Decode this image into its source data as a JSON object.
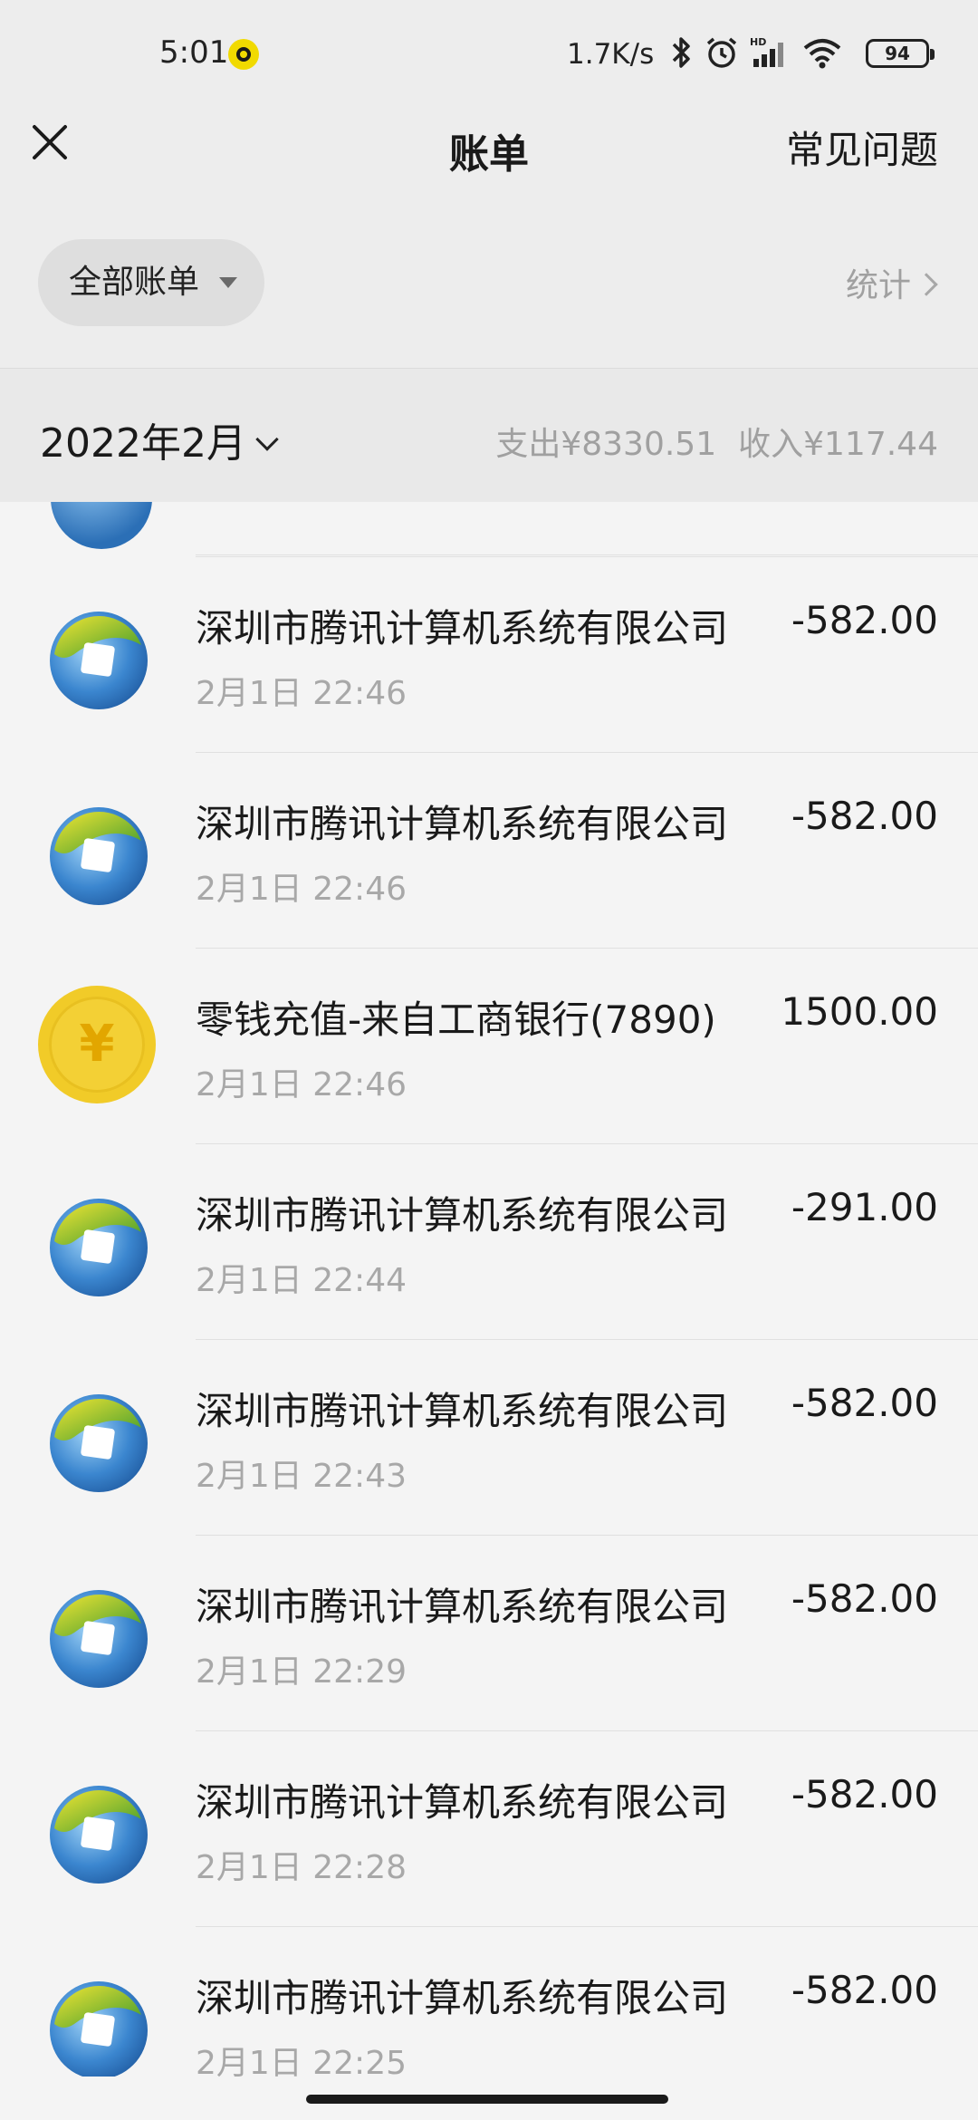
{
  "status_bar": {
    "time": "5:01",
    "net_speed": "1.7K/s",
    "battery": "94",
    "icons": [
      "bluetooth-icon",
      "alarm-icon",
      "hd-signal-icon",
      "wifi-icon",
      "battery-icon"
    ]
  },
  "header": {
    "title": "账单",
    "faq_label": "常见问题"
  },
  "filter": {
    "label": "全部账单",
    "stats_label": "统计"
  },
  "month": {
    "label": "2022年2月",
    "expense": "支出¥8330.51",
    "income": "收入¥117.44"
  },
  "transactions": [
    {
      "title": "深圳市腾讯计算机系统有限公司",
      "time": "2月1日 22:46",
      "amount": "-582.00",
      "icon": "tencent-icon"
    },
    {
      "title": "深圳市腾讯计算机系统有限公司",
      "time": "2月1日 22:46",
      "amount": "-582.00",
      "icon": "tencent-icon"
    },
    {
      "title": "零钱充值-来自工商银行(7890)",
      "time": "2月1日 22:46",
      "amount": "1500.00",
      "icon": "coin-icon"
    },
    {
      "title": "深圳市腾讯计算机系统有限公司",
      "time": "2月1日 22:44",
      "amount": "-291.00",
      "icon": "tencent-icon"
    },
    {
      "title": "深圳市腾讯计算机系统有限公司",
      "time": "2月1日 22:43",
      "amount": "-582.00",
      "icon": "tencent-icon"
    },
    {
      "title": "深圳市腾讯计算机系统有限公司",
      "time": "2月1日 22:29",
      "amount": "-582.00",
      "icon": "tencent-icon"
    },
    {
      "title": "深圳市腾讯计算机系统有限公司",
      "time": "2月1日 22:28",
      "amount": "-582.00",
      "icon": "tencent-icon"
    },
    {
      "title": "深圳市腾讯计算机系统有限公司",
      "time": "2月1日 22:25",
      "amount": "-582.00",
      "icon": "tencent-icon"
    }
  ],
  "coin_symbol": "¥",
  "colors": {
    "background": "#f4f4f4",
    "header_bg": "#ededed",
    "coin": "#f1cb28",
    "muted_text": "#a8a8a8"
  }
}
